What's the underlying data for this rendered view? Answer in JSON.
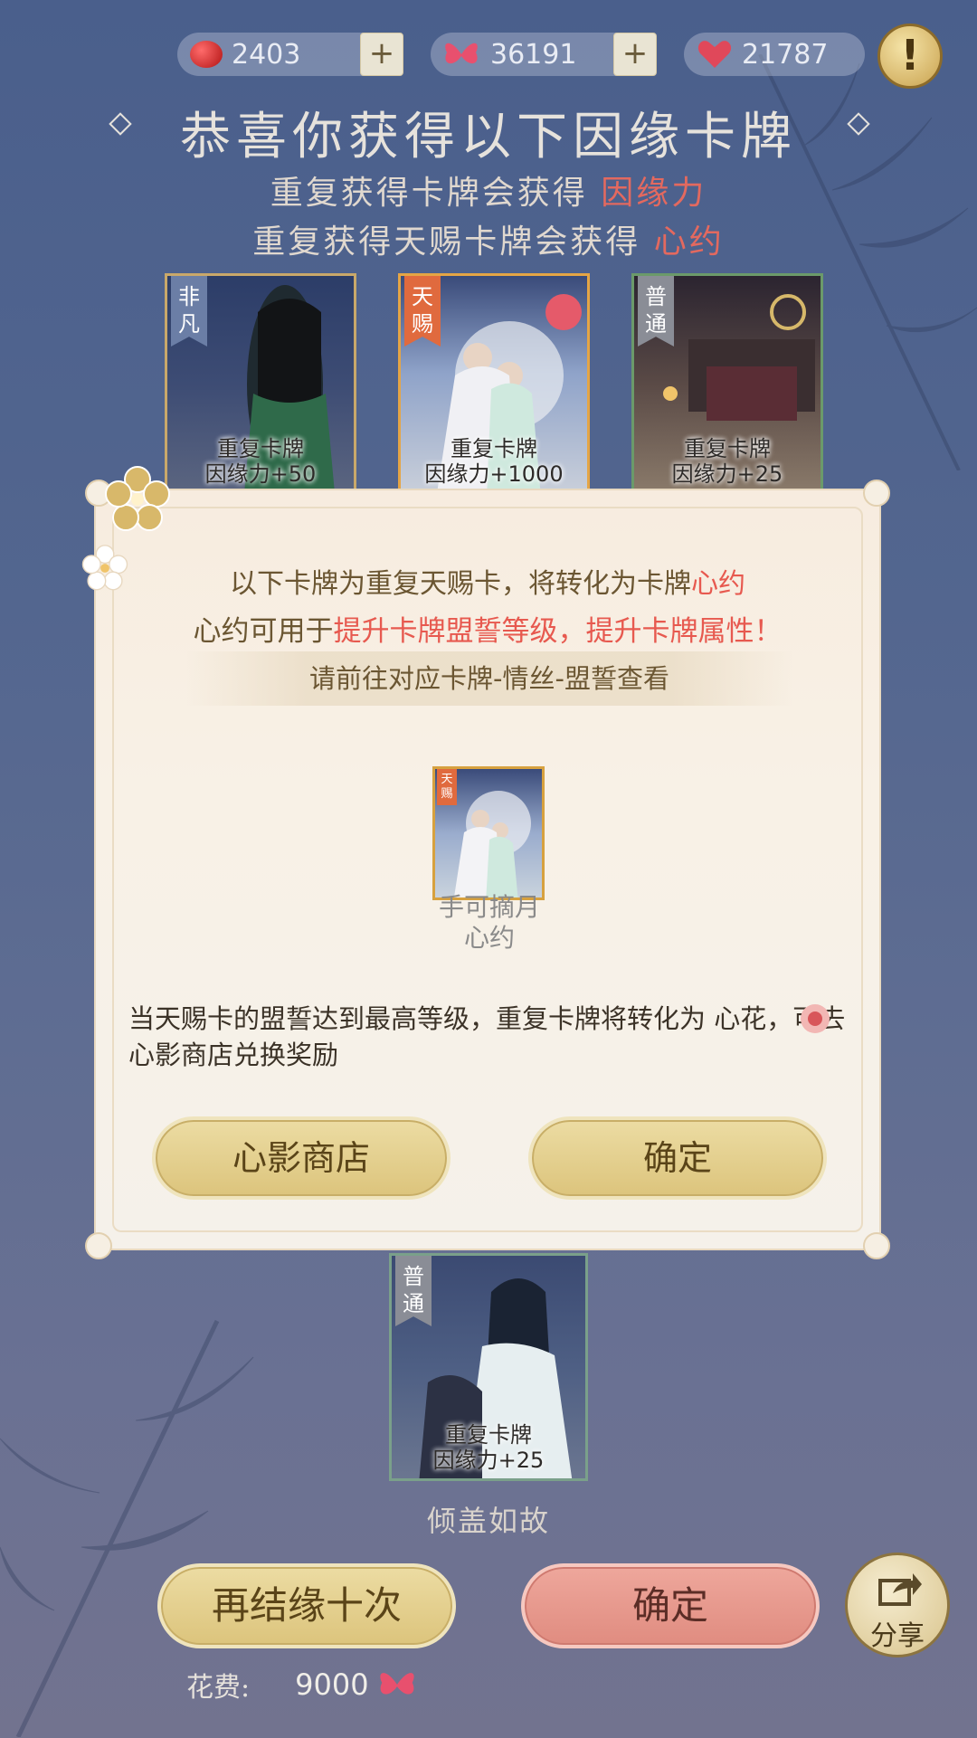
{
  "currencies": [
    {
      "name": "red-bean",
      "value": "2403",
      "color": "#d33a3a"
    },
    {
      "name": "butterfly",
      "value": "36191",
      "color": "#e84a6a"
    },
    {
      "name": "heart",
      "value": "21787",
      "color": "#e0485a"
    }
  ],
  "plus_label": "+",
  "alert_label": "!",
  "header": {
    "title": "恭喜你获得以下因缘卡牌",
    "line1_prefix": "重复获得卡牌会获得 ",
    "line1_highlight": "因缘力",
    "line2_prefix": "重复获得天赐卡牌会获得 ",
    "line2_highlight": "心约"
  },
  "cards_top": [
    {
      "rarity": "非凡",
      "line1": "重复卡牌",
      "line2": "因缘力+50",
      "tag_color": "#6b7ea6"
    },
    {
      "rarity": "天赐",
      "line1": "重复卡牌",
      "line2": "因缘力+1000",
      "tag_color": "#e06a3e"
    },
    {
      "rarity": "普通",
      "line1": "重复卡牌",
      "line2": "因缘力+25",
      "tag_color": "#8a8d96"
    }
  ],
  "modal": {
    "line1_prefix": "以下卡牌为重复天赐卡，将转化为卡牌",
    "line1_highlight": "心约",
    "line2_prefix": "心约可用于",
    "line2_highlight": "提升卡牌盟誓等级，提升卡牌属性！",
    "hint": "请前往对应卡牌-情丝-盟誓查看",
    "card_tag": "天赐",
    "card_name": "手可摘月",
    "card_reward": "心约",
    "note": "当天赐卡的盟誓达到最高等级，重复卡牌将转化为 心花，可去心影商店兑换奖励",
    "btn_shop": "心影商店",
    "btn_confirm": "确定"
  },
  "card_bottom": {
    "rarity": "普通",
    "line1": "重复卡牌",
    "line2": "因缘力+25",
    "name": "倾盖如故",
    "tag_color": "#8a8d96"
  },
  "footer": {
    "btn_again": "再结缘十次",
    "btn_confirm": "确定",
    "share": "分享",
    "cost_label": "花费:",
    "cost_value": "9000"
  }
}
